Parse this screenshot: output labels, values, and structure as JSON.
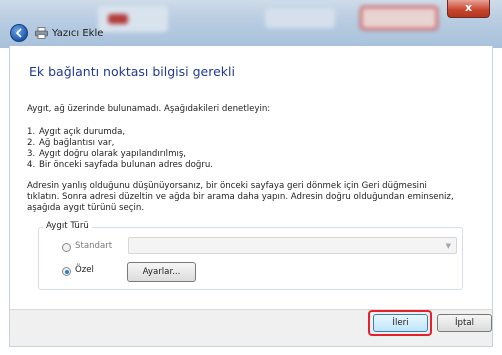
{
  "window": {
    "title": "Yazıcı Ekle",
    "close_label": "x"
  },
  "page": {
    "heading": "Ek bağlantı noktası bilgisi gerekli",
    "intro": "Aygıt, ağ üzerinde bulunamadı.  Aşağıdakileri denetleyin:",
    "checklist": [
      {
        "num": "1.",
        "text": "Aygıt açık durumda,"
      },
      {
        "num": "2.",
        "text": "Ağ bağlantısı var,"
      },
      {
        "num": "3.",
        "text": "Aygıt doğru olarak yapılandırılmış,"
      },
      {
        "num": "4.",
        "text": "Bir önceki sayfada bulunan adres doğru."
      }
    ],
    "instructions_line1": "Adresin yanlış olduğunu düşünüyorsanız, bir önceki sayfaya geri dönmek için Geri düğmesini",
    "instructions_line2": "tıklatın. Sonra adresi düzeltin ve ağda bir arama daha yapın. Adresin doğru olduğundan eminseniz,",
    "instructions_line3": "aşağıda aygıt türünü seçin."
  },
  "device_type": {
    "group_label": "Aygıt Türü",
    "standard_label": "Standart",
    "standard_selected": false,
    "standard_select_value": "",
    "custom_label": "Özel",
    "custom_selected": true,
    "settings_button": "Ayarlar..."
  },
  "footer": {
    "next_button": "İleri",
    "cancel_button": "İptal"
  },
  "colors": {
    "heading": "#1f3a93",
    "highlight": "#e2232b",
    "radio_selected": "#2b7de0"
  }
}
